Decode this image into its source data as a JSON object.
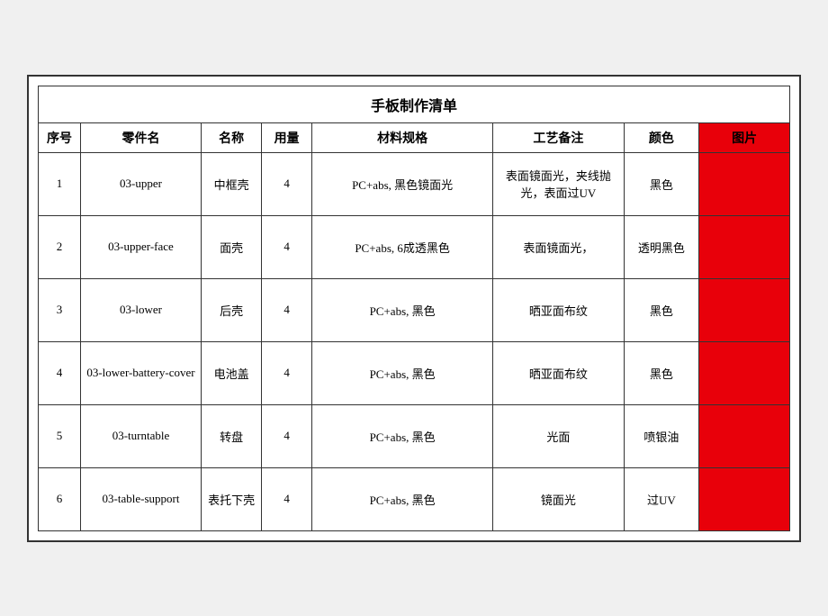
{
  "title": "手板制作清单",
  "headers": {
    "seq": "序号",
    "part_code": "零件名",
    "part_name": "名称",
    "qty": "用量",
    "spec": "材料规格",
    "craft": "工艺备注",
    "color": "颜色",
    "image": "图片"
  },
  "rows": [
    {
      "seq": "1",
      "part_code": "03-upper",
      "part_name": "中框壳",
      "qty": "4",
      "spec": "PC+abs, 黑色镜面光",
      "craft": "表面镜面光，夹线抛光，表面过UV",
      "color": "黑色"
    },
    {
      "seq": "2",
      "part_code": "03-upper-face",
      "part_name": "面壳",
      "qty": "4",
      "spec": "PC+abs, 6成透黑色",
      "craft": "表面镜面光，",
      "color": "透明黑色"
    },
    {
      "seq": "3",
      "part_code": "03-lower",
      "part_name": "后壳",
      "qty": "4",
      "spec": "PC+abs, 黑色",
      "craft": "晒亚面布纹",
      "color": "黑色"
    },
    {
      "seq": "4",
      "part_code": "03-lower-battery-cover",
      "part_name": "电池盖",
      "qty": "4",
      "spec": "PC+abs, 黑色",
      "craft": "晒亚面布纹",
      "color": "黑色"
    },
    {
      "seq": "5",
      "part_code": "03-turntable",
      "part_name": "转盘",
      "qty": "4",
      "spec": "PC+abs, 黑色",
      "craft": "光面",
      "color": "喷银油"
    },
    {
      "seq": "6",
      "part_code": "03-table-support",
      "part_name": "表托下壳",
      "qty": "4",
      "spec": "PC+abs, 黑色",
      "craft": "镜面光",
      "color": "过UV"
    }
  ]
}
